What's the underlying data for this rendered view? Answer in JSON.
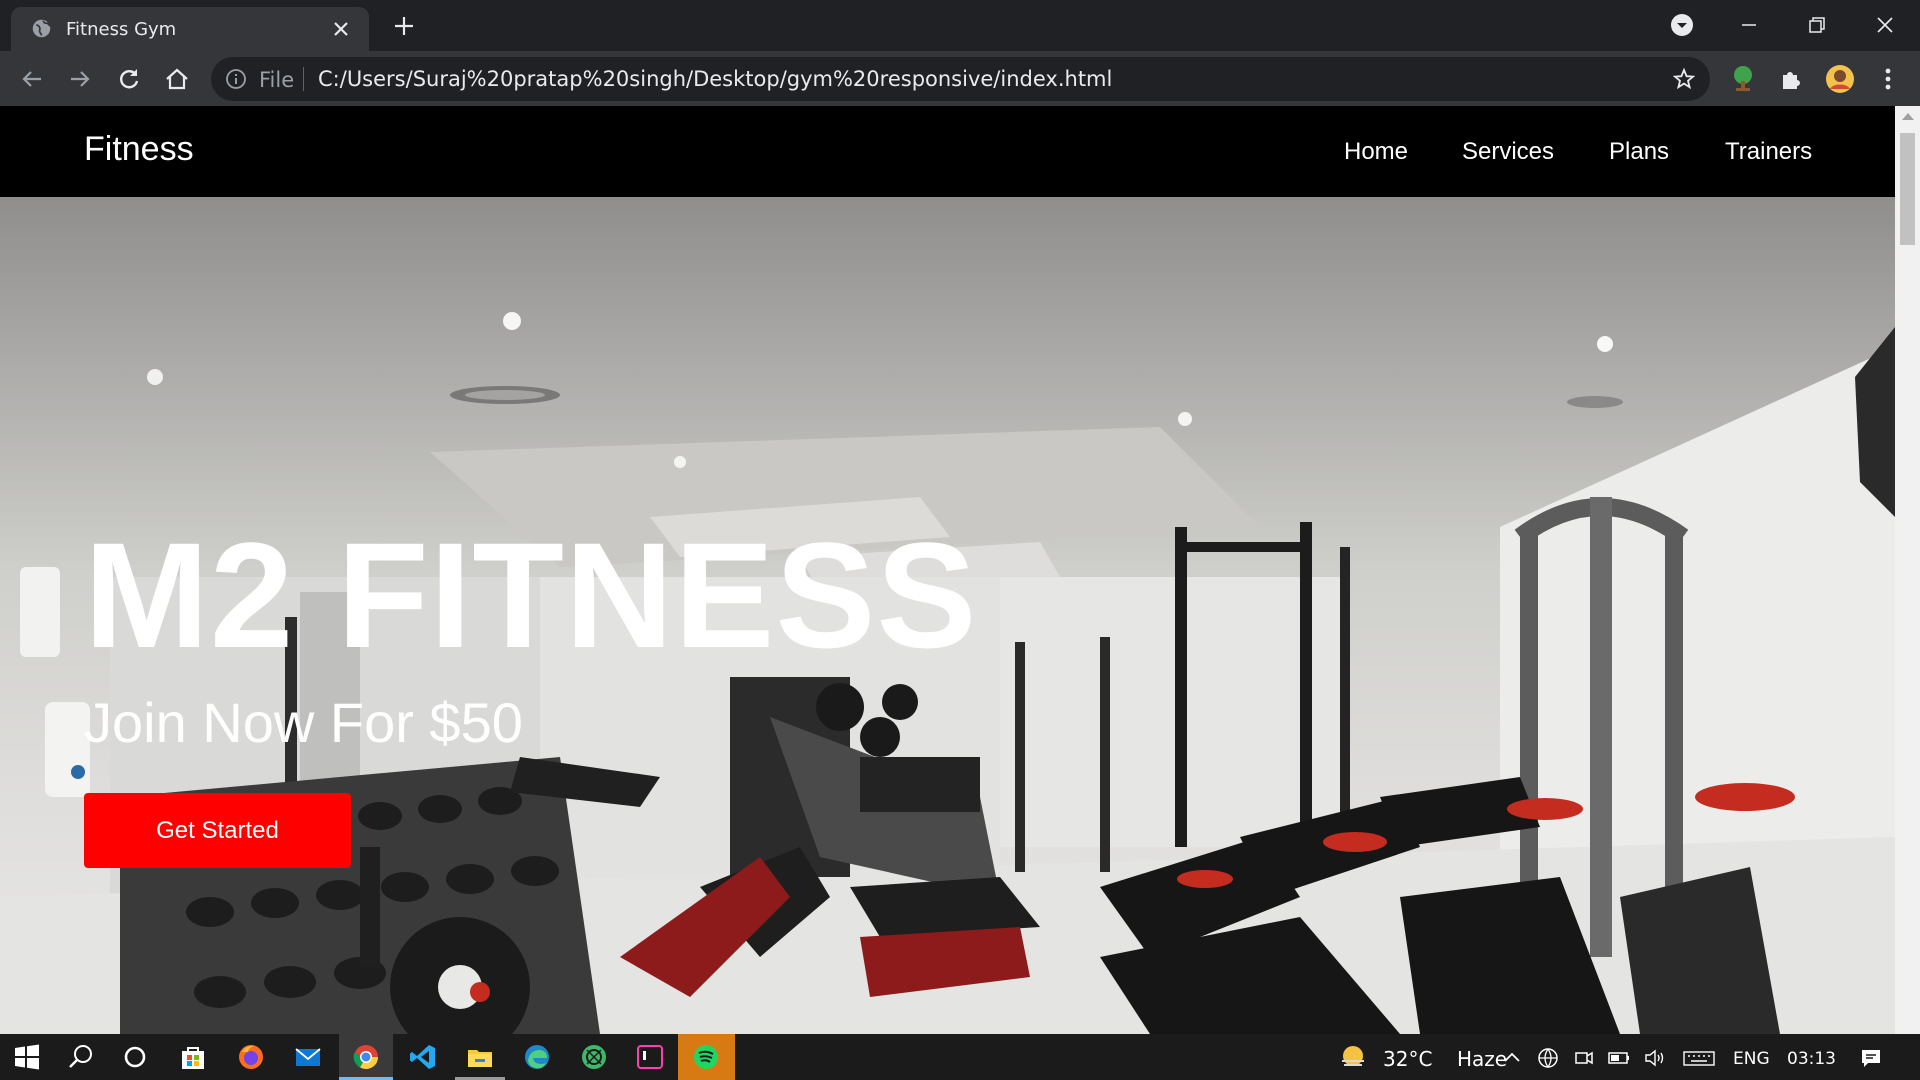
{
  "browser": {
    "tab_title": "Fitness Gym",
    "file_label": "File",
    "url": "C:/Users/Suraj%20pratap%20singh/Desktop/gym%20responsive/index.html"
  },
  "site": {
    "brand": "Fitness",
    "nav": [
      "Home",
      "Services",
      "Plans",
      "Trainers"
    ],
    "hero_title": "M2 FITNESS",
    "hero_subtitle": "Join Now For $50",
    "cta_label": "Get Started",
    "cta_color": "#ff0000"
  },
  "taskbar": {
    "weather_temp": "32°C",
    "weather_desc": "Haze",
    "language": "ENG",
    "time": "03:13",
    "pinned_apps": [
      "windows-start-icon",
      "search-icon",
      "cortana-icon",
      "store-icon",
      "firefox-icon",
      "mail-icon",
      "chrome-icon",
      "vscode-icon",
      "file-explorer-icon",
      "edge-icon",
      "cyberghost-icon",
      "terminal-icon",
      "spotify-icon"
    ]
  }
}
